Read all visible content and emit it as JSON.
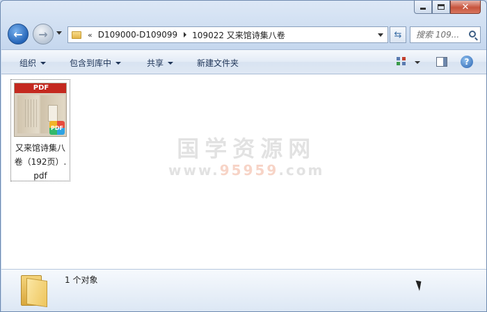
{
  "window": {
    "caption_buttons": {
      "minimize": "minimize",
      "maximize": "maximize",
      "close": "✕"
    }
  },
  "nav": {
    "back_icon": "arrow-left-icon",
    "forward_icon": "arrow-right-icon"
  },
  "address": {
    "overflow": "«",
    "crumbs": [
      "D109000-D109099",
      "109022 又来馆诗集八卷"
    ]
  },
  "search": {
    "placeholder": "搜索 109..."
  },
  "toolbar": {
    "organize": "组织",
    "include_in_library": "包含到库中",
    "share": "共享",
    "new_folder": "新建文件夹",
    "help": "?"
  },
  "files": [
    {
      "name": "又来馆诗集八卷（192页）.pdf",
      "thumb_band": "PDF",
      "badge": "PDF"
    }
  ],
  "watermark": {
    "title": "国学资源网",
    "url_prefix": "www.",
    "url_highlight": "95959",
    "url_suffix": ".com"
  },
  "details": {
    "count_text": "1 个对象"
  }
}
